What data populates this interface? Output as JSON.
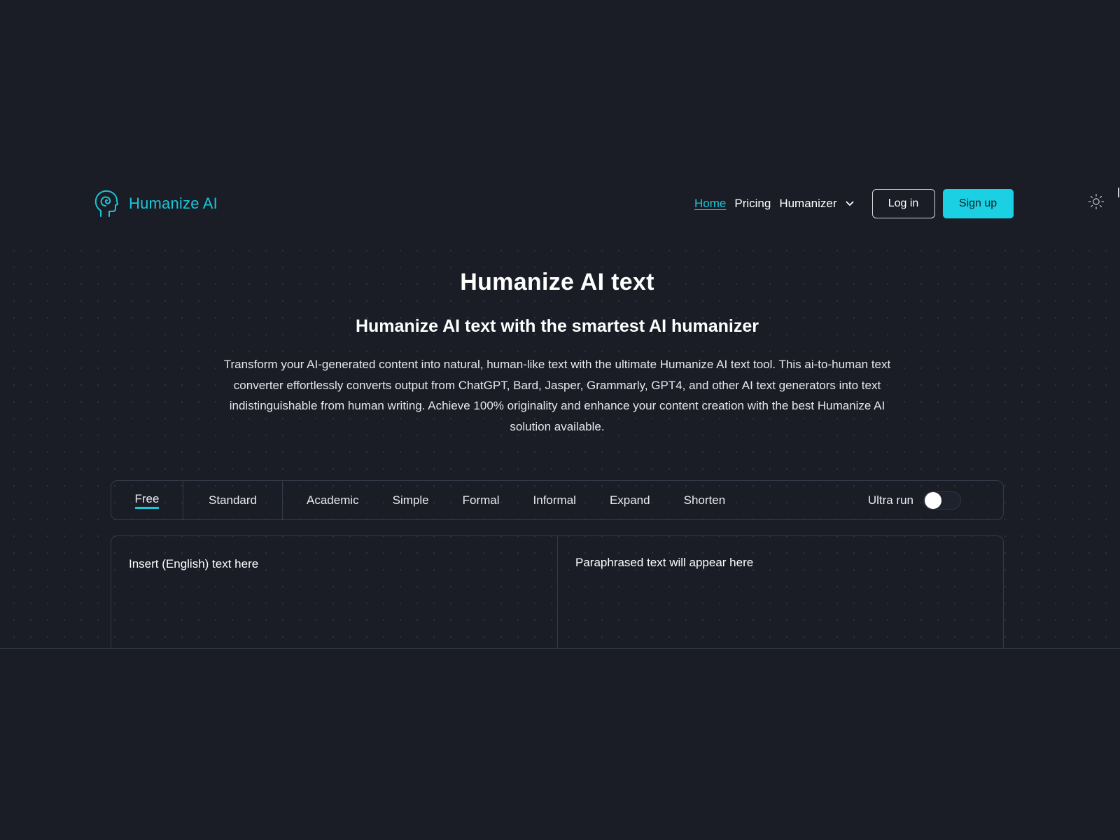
{
  "header": {
    "brand": "Humanize AI",
    "logo_icon": "head-spiral-icon",
    "nav": {
      "home": "Home",
      "pricing": "Pricing",
      "humanizer": "Humanizer"
    },
    "login": "Log in",
    "signup": "Sign up",
    "theme_icon": "sun-icon"
  },
  "hero": {
    "title": "Humanize AI text",
    "subtitle": "Humanize AI text with the smartest AI humanizer",
    "description": "Transform your AI-generated content into natural, human-like text with the ultimate Humanize AI text tool. This ai-to-human text converter effortlessly converts output from ChatGPT, Bard, Jasper, Grammarly, GPT4, and other AI text generators into text indistinguishable from human writing. Achieve 100% originality and enhance your content creation with the best Humanize AI solution available."
  },
  "modes": {
    "tabs": [
      "Free",
      "Standard",
      "Academic",
      "Simple",
      "Formal",
      "Informal",
      "Expand",
      "Shorten"
    ],
    "selected": "Free",
    "ultra_run_label": "Ultra run",
    "ultra_run_on": false
  },
  "editor": {
    "input_placeholder": "Insert (English) text here",
    "input_value": "",
    "output_placeholder": "Paraphrased text will appear here"
  },
  "colors": {
    "background": "#1a1d26",
    "accent": "#19c6d8",
    "signup_bg": "#1ad0e2",
    "border": "#343a47"
  }
}
